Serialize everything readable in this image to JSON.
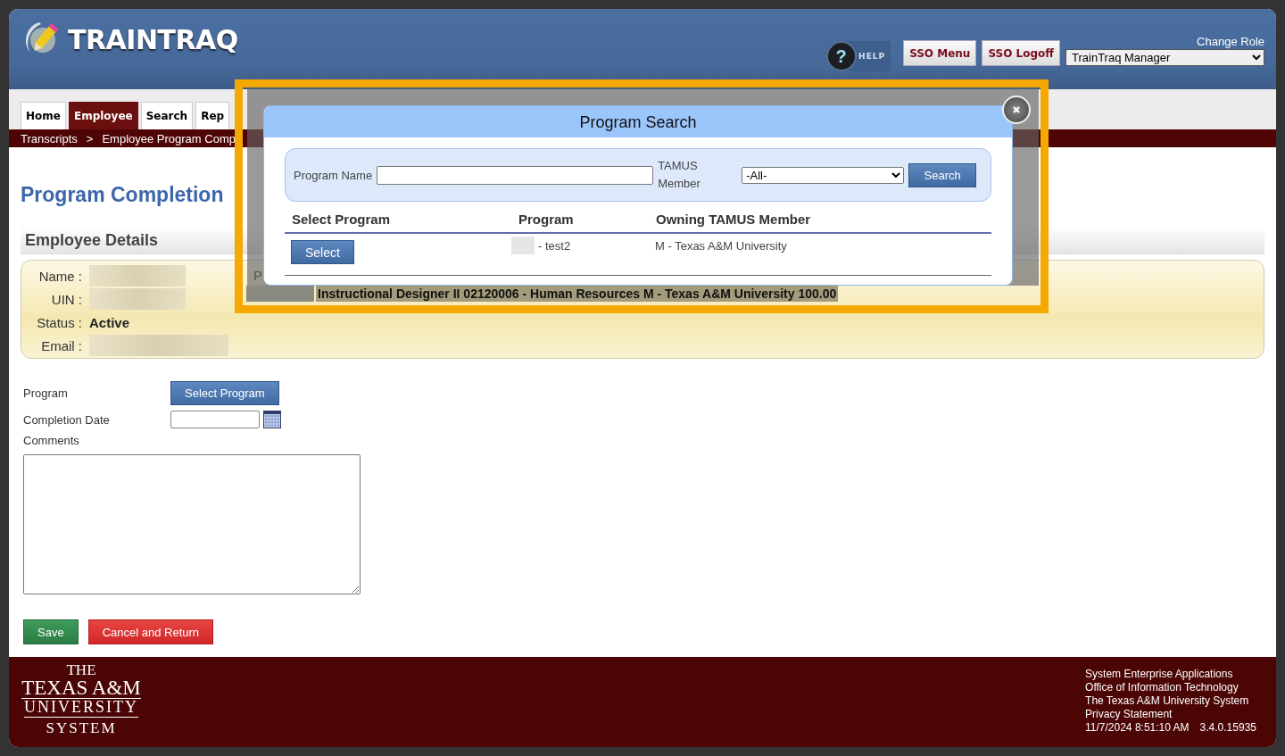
{
  "header": {
    "logo_text": "TRAINTRAQ",
    "help_icon": "?",
    "help_label": "HELP",
    "buttons": [
      "SSO Menu",
      "SSO Logoff"
    ],
    "change_role_label": "Change Role",
    "role_value": "TrainTraq Manager"
  },
  "tabs": [
    {
      "label": "Home",
      "selected": false
    },
    {
      "label": "Employee",
      "selected": true
    },
    {
      "label": "Search",
      "selected": false
    },
    {
      "label": "Rep",
      "selected": false
    }
  ],
  "breadcrumb": {
    "items": [
      "Transcripts",
      "Employee Program Comp"
    ],
    "separator": ">"
  },
  "page_title": "Program Completion",
  "section_title": "Employee Details",
  "details": [
    {
      "label": "Name :",
      "kind": "redacted"
    },
    {
      "label": "UIN :",
      "kind": "redacted"
    },
    {
      "label": "Status :",
      "kind": "text",
      "value": "Active"
    },
    {
      "label": "Email :",
      "kind": "redacted"
    }
  ],
  "position": {
    "label": "P",
    "row": "Instructional Designer II  02120006 - Human Resources  M - Texas A&M University   100.00"
  },
  "form": {
    "program_label": "Program",
    "select_program_button": "Select Program",
    "completion_date_label": "Completion Date",
    "comments_label": "Comments",
    "save_button": "Save",
    "cancel_button": "Cancel and Return"
  },
  "footer": {
    "logo_lines": [
      "THE",
      "TEXAS A&M",
      "UNIVERSITY",
      "SYSTEM"
    ],
    "links": [
      "System Enterprise Applications",
      "Office of Information Technology",
      "The Texas A&M University System",
      "Privacy Statement"
    ],
    "timestamp": "11/7/2024 8:51:10 AM",
    "version": "3.4.0.15935"
  },
  "modal": {
    "title": "Program Search",
    "program_name_label": "Program Name",
    "member_label": "TAMUS Member",
    "member_value": "-All-",
    "search_button": "Search",
    "columns": [
      "Select Program",
      "Program",
      "Owning TAMUS Member"
    ],
    "rows": [
      {
        "select_label": "Select",
        "program": "- test2",
        "owner": "M - Texas A&M University"
      }
    ]
  }
}
